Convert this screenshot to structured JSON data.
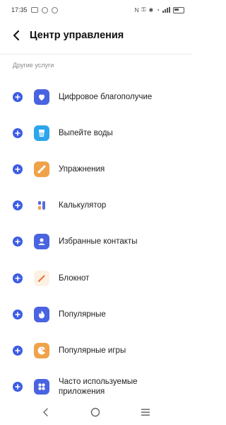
{
  "status_bar": {
    "time": "17:35",
    "right_text": "N",
    "battery": "38"
  },
  "header": {
    "title": "Центр управления"
  },
  "section": {
    "label": "Другие услуги"
  },
  "items": [
    {
      "label": "Цифровое благополучие",
      "icon": "digital-wellbeing-icon",
      "color": "#4a63e0"
    },
    {
      "label": "Выпейте воды",
      "icon": "water-cup-icon",
      "color": "#2ea5ec"
    },
    {
      "label": "Упражнения",
      "icon": "exercise-icon",
      "color": "#f0a24a"
    },
    {
      "label": "Калькулятор",
      "icon": "calculator-icon",
      "color": "#5a6bd8"
    },
    {
      "label": "Избранные контакты",
      "icon": "contacts-icon",
      "color": "#4a63e0"
    },
    {
      "label": "Блокнот",
      "icon": "notepad-icon",
      "color": "#f26a36"
    },
    {
      "label": "Популярные",
      "icon": "popular-flame-icon",
      "color": "#4a63e0"
    },
    {
      "label": "Популярные игры",
      "icon": "games-icon",
      "color": "#f0a24a"
    },
    {
      "label": "Часто используемые приложения",
      "icon": "apps-grid-icon",
      "color": "#4a63e0"
    }
  ],
  "nav": {
    "back": "back-nav-icon",
    "home": "home-nav-icon",
    "menu": "menu-nav-icon"
  }
}
